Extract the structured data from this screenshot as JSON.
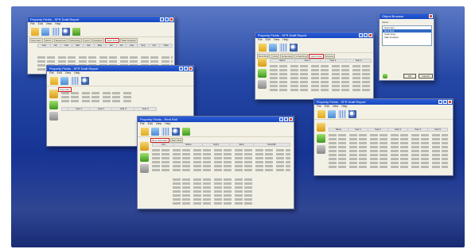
{
  "colors": {
    "backdrop_top": "#5a78c4",
    "backdrop_bottom": "#0b1f6c",
    "titlebar": "#1747c0",
    "window_bg": "#f3f1e6",
    "highlight": "#d11a1a"
  },
  "windows": {
    "w1": {
      "title": "Property Fields - SFR Draft Report",
      "menu": [
        "File",
        "Edit",
        "View",
        "Help"
      ],
      "tabs": [
        "Summary",
        "Rents",
        "Expenses",
        "Financing",
        "Loan",
        "Analysis",
        "Cash Flow",
        "Sale Analysis"
      ],
      "highlighted_tab": "Cash Flow",
      "table_header": [
        "Year",
        "Jan",
        "Feb",
        "Mar",
        "Apr",
        "May",
        "Jun",
        "Jul",
        "Aug",
        "Sep",
        "Oct",
        "Total"
      ]
    },
    "w2": {
      "title": "Property Fields - SFR Draft Report",
      "menu": [
        "File",
        "Edit",
        "View",
        "Help"
      ],
      "highlighted_tab": "Summary",
      "table_header": [
        "",
        "Year 1",
        "Year 2",
        "Year 3",
        "Year 4"
      ]
    },
    "w3": {
      "title": "Property Fields - SFR Draft Report",
      "menu": [
        "File",
        "Edit",
        "View",
        "Help"
      ],
      "tabs": [
        "Rent Roll",
        "Units",
        "Expenses",
        "Financing",
        "Cash Flow",
        "Income"
      ],
      "highlighted_tab": "Cash Flow",
      "table_header": [
        "Name",
        "Year 1",
        "Year 2",
        "Year 3"
      ]
    },
    "w4": {
      "title": "Property Fields - SFR Draft Report",
      "menu": [
        "File",
        "Edit",
        "View",
        "Help"
      ],
      "table_header": [
        "Name",
        "Year 1",
        "Year 2",
        "Year 3",
        "Year 4",
        "Year 5"
      ]
    },
    "w5": {
      "title": "Property Fields - Rent Roll",
      "menu": [
        "File",
        "Edit",
        "View",
        "Help"
      ],
      "tabs": [
        "Rent Schedule",
        "Rent Roll"
      ],
      "table_header": [
        "Unit",
        "Name",
        "Sq Ft",
        "Rent",
        "Rent/SF"
      ]
    },
    "dialog": {
      "title": "Object Browser",
      "field_label": "Select",
      "list": [
        "Summary",
        "Rent Roll",
        "Cash Flow",
        "Sale Analysis"
      ],
      "selected_index": 1,
      "ok_label": "OK",
      "cancel_label": "Cancel"
    }
  }
}
